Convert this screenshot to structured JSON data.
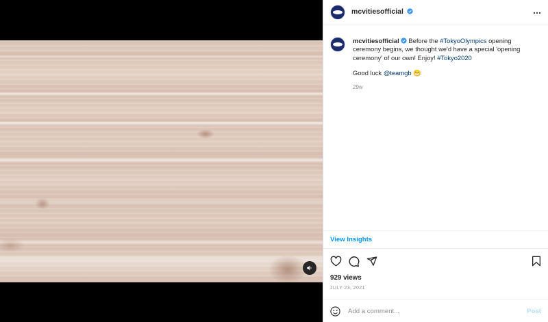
{
  "media": {
    "sound_icon": "speaker-icon"
  },
  "header": {
    "username": "mcvitiesofficial",
    "verified_icon": "verified-badge-icon",
    "more_icon": "more-dots-icon"
  },
  "caption": {
    "username": "mcvitiesofficial",
    "text_before": " Before the ",
    "hashtag1": "#TokyoOlympics",
    "text_middle": " opening ceremony begins, we thought we'd have a special 'opening ceremony' of our own! Enjoy! ",
    "hashtag2": "#Tokyo2020",
    "goodluck_text": "Good luck ",
    "mention": "@teamgb",
    "emoji": "😁",
    "time_ago": "29w"
  },
  "insights": {
    "label": "View Insights"
  },
  "actions": {
    "like_icon": "heart-icon",
    "comment_icon": "comment-icon",
    "share_icon": "share-icon",
    "save_icon": "bookmark-icon"
  },
  "stats": {
    "views": "929 views",
    "date": "JULY 23, 2021"
  },
  "comment": {
    "placeholder": "Add a comment...",
    "post_label": "Post",
    "emoji_icon": "smiley-icon"
  },
  "colors": {
    "link": "#00376b",
    "insights": "#0095f6",
    "post_disabled": "#b2dffc",
    "brand_avatar": "#1a2a6c"
  }
}
